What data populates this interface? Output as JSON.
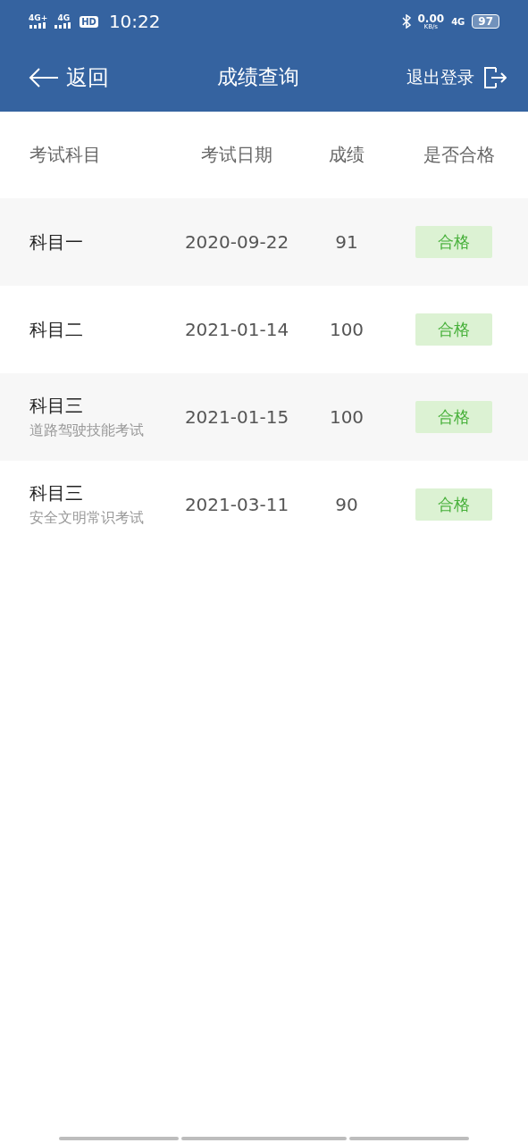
{
  "status_bar": {
    "signals": [
      "4G+",
      "4G"
    ],
    "hd": "HD",
    "time": "10:22",
    "net_speed": "0.00",
    "net_unit": "KB/s",
    "network": "4G",
    "battery": "97"
  },
  "nav": {
    "back": "返回",
    "title": "成绩查询",
    "logout": "退出登录"
  },
  "table": {
    "columns": [
      "考试科目",
      "考试日期",
      "成绩",
      "是否合格"
    ],
    "rows": [
      {
        "subject": "科目一",
        "date": "2020-09-22",
        "score": "91",
        "result": "合格",
        "passed": true
      },
      {
        "subject": "科目二",
        "date": "2021-01-14",
        "score": "100",
        "result": "合格",
        "passed": true
      },
      {
        "subject": "科目三",
        "note": "道路驾驶技能考试",
        "date": "2021-01-15",
        "score": "100",
        "result": "合格",
        "passed": true
      },
      {
        "subject": "科目三",
        "note": "安全文明常识考试",
        "date": "2021-03-11",
        "score": "90",
        "result": "合格",
        "passed": true
      }
    ]
  }
}
